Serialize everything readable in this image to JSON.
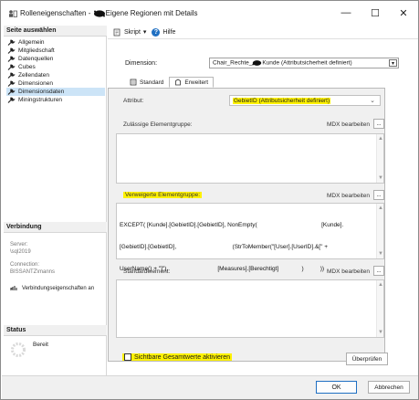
{
  "window": {
    "title_prefix": "Rolleneigenschaften - ",
    "title_suffix": "Eigene Regionen mit Details",
    "minimize_glyph": "—",
    "maximize_glyph": "☐",
    "close_glyph": "✕"
  },
  "left_pane": {
    "pages_header": "Seite auswählen",
    "pages": [
      {
        "label": "Allgemein",
        "selected": false
      },
      {
        "label": "Mitgliedschaft",
        "selected": false
      },
      {
        "label": "Datenquellen",
        "selected": false
      },
      {
        "label": "Cubes",
        "selected": false
      },
      {
        "label": "Zellendaten",
        "selected": false
      },
      {
        "label": "Dimensionen",
        "selected": false
      },
      {
        "label": "Dimensionsdaten",
        "selected": true
      },
      {
        "label": "Miningstrukturen",
        "selected": false
      }
    ],
    "connection_header": "Verbindung",
    "server_label": "Server:",
    "server_value": "\\sql2019",
    "connection_label": "Connection:",
    "connection_value": "BISSANTZ\\manns",
    "connection_properties_link": "Verbindungseigenschaften an",
    "status_header": "Status",
    "status_value": "Bereit"
  },
  "toolbar": {
    "script_label": "Skript",
    "script_caret": "▾",
    "help_label": "Hilfe"
  },
  "dimension": {
    "label": "Dimension:",
    "value_prefix": "Chair_Rechte_",
    "value_suffix": "Kunde (Attributsicherheit definiert)",
    "caret": "▾"
  },
  "tabs": [
    {
      "label": "Standard",
      "active": false
    },
    {
      "label": "Erweitert",
      "active": true
    }
  ],
  "advanced": {
    "attribute_label": "Attribut:",
    "attribute_value": "GebietID (Attributsicherheit definiert)",
    "attribute_chevron": "⌄",
    "allowed_label": "Zulässige Elementgruppe:",
    "denied_label": "Verweigerte Elementgruppe:",
    "default_label": "Standardelement:",
    "mdx_edit_label": "MDX bearbeiten",
    "dots_label": "...",
    "denied_mdx": [
      "EXCEPT( [Kunde].[GebietID].[GebietID], NonEmpty(                                       [Kunde].",
      "[GebietID].[GebietID],                                  (StrToMember(\"[User].[UserID].&[\" +",
      "UserName() + \"]\"),                              [Measures].[Berechtigt]              )          ))"
    ],
    "visual_totals_label": "Sichtbare Gesamtwerte aktivieren",
    "visual_totals_checked": false,
    "check_button": "Überprüfen"
  },
  "footer": {
    "ok_label": "OK",
    "cancel_label": "Abbrechen"
  },
  "colors": {
    "highlight": "#fff200",
    "selection": "#cce4f7",
    "accent": "#1f6fc2"
  }
}
